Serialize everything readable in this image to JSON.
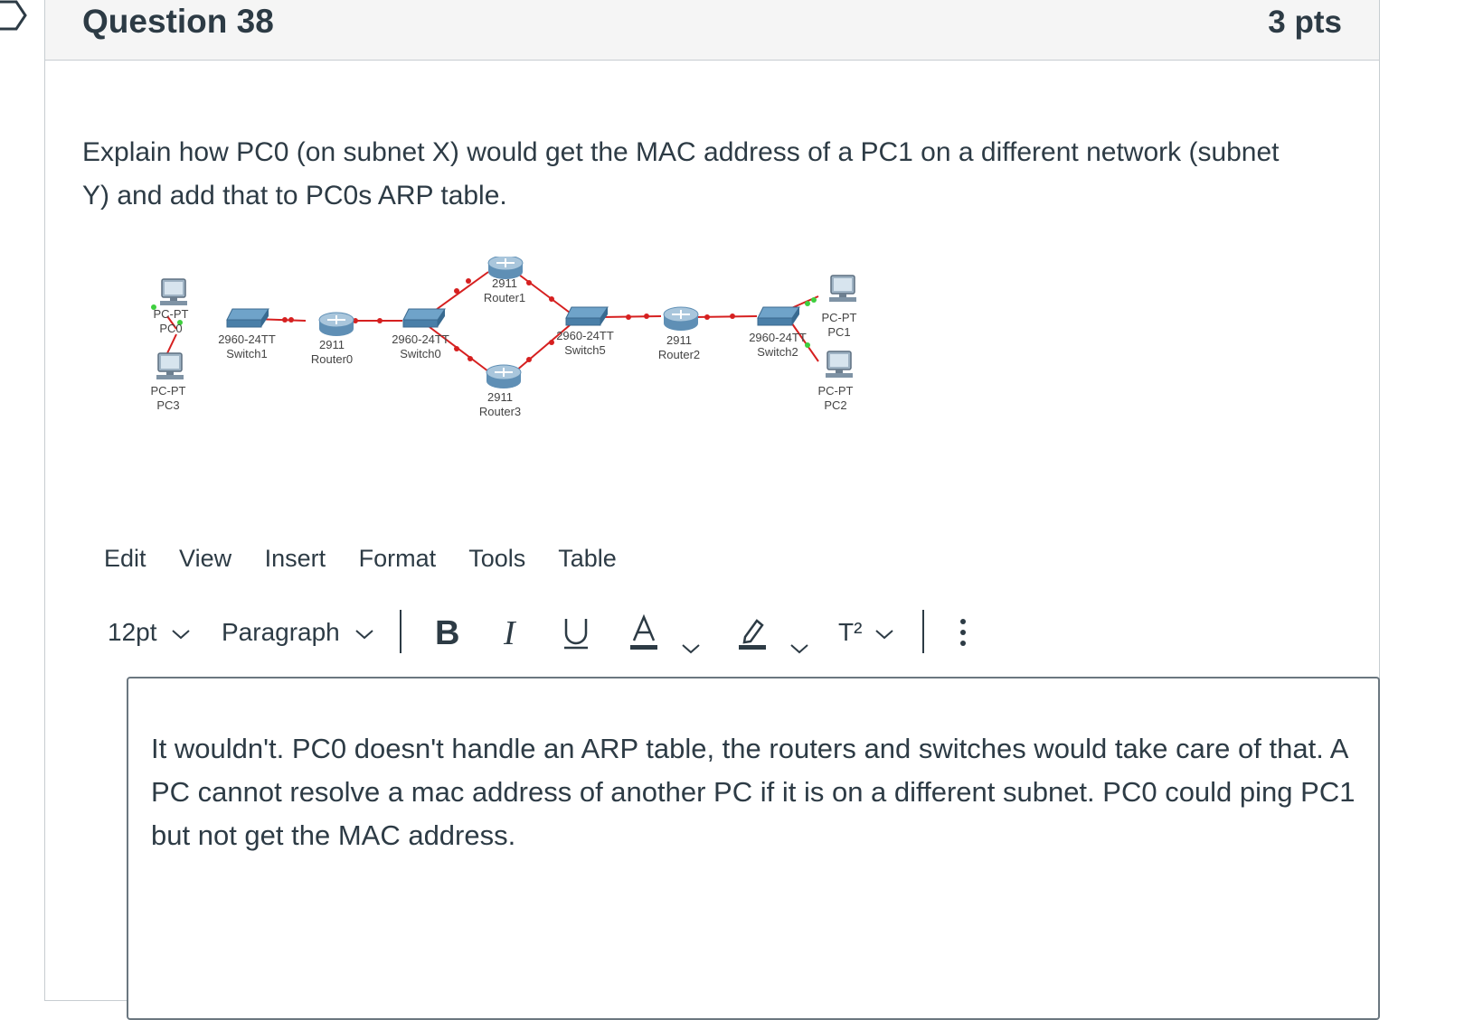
{
  "question": {
    "title": "Question 38",
    "points": "3 pts"
  },
  "prompt": "Explain how PC0 (on subnet X) would get the MAC address of a PC1 on a different network (subnet Y) and add that to PC0s ARP table.",
  "diagram": {
    "devices": [
      {
        "type": "PC-PT",
        "name": "PC0"
      },
      {
        "type": "PC-PT",
        "name": "PC3"
      },
      {
        "type": "2960-24TT",
        "name": "Switch1"
      },
      {
        "type": "2911",
        "name": "Router0"
      },
      {
        "type": "2960-24TT",
        "name": "Switch0"
      },
      {
        "type": "2911",
        "name": "Router1"
      },
      {
        "type": "2911",
        "name": "Router3"
      },
      {
        "type": "2960-24TT",
        "name": "Switch5"
      },
      {
        "type": "2911",
        "name": "Router2"
      },
      {
        "type": "2960-24TT",
        "name": "Switch2"
      },
      {
        "type": "PC-PT",
        "name": "PC1"
      },
      {
        "type": "PC-PT",
        "name": "PC2"
      }
    ]
  },
  "editor": {
    "menu": [
      "Edit",
      "View",
      "Insert",
      "Format",
      "Tools",
      "Table"
    ],
    "font_size": "12pt",
    "block_format": "Paragraph",
    "toolbar_icons": [
      "bold-icon",
      "italic-icon",
      "underline-icon",
      "text-color-icon",
      "highlight-icon",
      "superscript-icon",
      "more-options-icon"
    ],
    "superscript_label": "T²",
    "answer": "It wouldn't. PC0 doesn't handle an ARP table, the routers and switches would take care of that. A PC cannot resolve a mac address of another PC if it is on a different subnet. PC0 could ping PC1 but not get the MAC address."
  }
}
